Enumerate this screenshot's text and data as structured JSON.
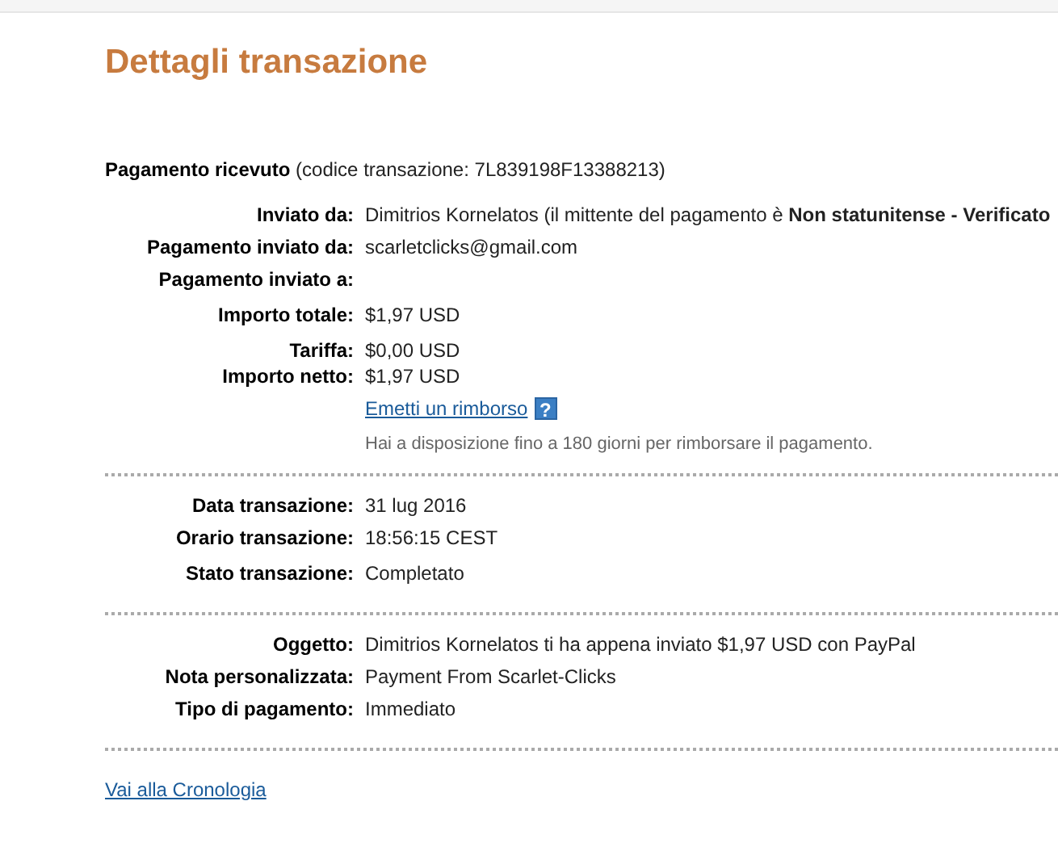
{
  "title": "Dettagli transazione",
  "summary": {
    "label": "Pagamento ricevuto",
    "detail": "(codice transazione: 7L839198F13388213)"
  },
  "sections": [
    {
      "groups": [
        [
          {
            "label": "Inviato da:",
            "value": "Dimitrios Kornelatos (il mittente del pagamento è **Non statunitense - Verificato**"
          },
          {
            "label": "Pagamento inviato da:",
            "value": "scarletclicks@gmail.com"
          },
          {
            "label": "Pagamento inviato a:"
          }
        ],
        [
          {
            "label": "Importo totale:",
            "value": "$1,97 USD"
          }
        ],
        [
          {
            "label": "Tariffa:",
            "value": "$0,00 USD"
          },
          {
            "label": "Importo netto:",
            "value": "$1,97 USD"
          }
        ]
      ],
      "refund": {
        "link": "Emetti un rimborso",
        "help": "?",
        "note": "Hai a disposizione fino a 180 giorni per rimborsare il pagamento."
      }
    },
    {
      "groups": [
        [
          {
            "label": "Data transazione:",
            "value": "31 lug 2016"
          },
          {
            "label": "Orario transazione:",
            "value": "18:56:15 CEST"
          }
        ],
        [
          {
            "label": "Stato transazione:",
            "value": "Completato"
          }
        ]
      ]
    },
    {
      "groups": [
        [
          {
            "label": "Oggetto:",
            "value": "Dimitrios Kornelatos ti ha appena inviato $1,97 USD con PayPal"
          },
          {
            "label": "Nota personalizzata:",
            "value": "Payment From Scarlet-Clicks"
          },
          {
            "label": "Tipo di pagamento:",
            "value": "Immediato"
          }
        ]
      ]
    }
  ],
  "footer_link": "Vai alla Cronologia"
}
